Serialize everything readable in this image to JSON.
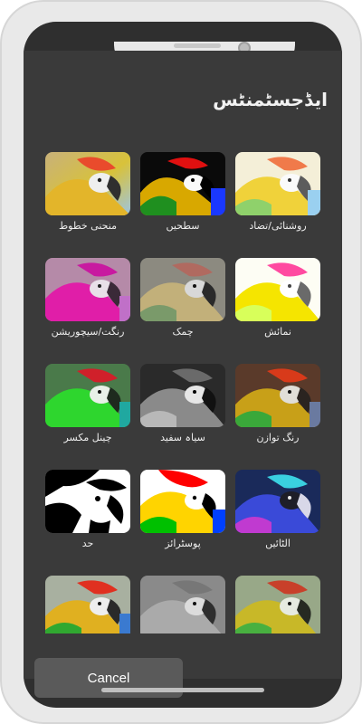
{
  "header": {
    "title": "ایڈجسٹمنٹس"
  },
  "actions": {
    "cancel_label": "Cancel"
  },
  "effects": [
    {
      "label": "منحنی خطوط"
    },
    {
      "label": "سطحیں"
    },
    {
      "label": "روشنائی/تضاد"
    },
    {
      "label": "رنگت/سیچوریشن"
    },
    {
      "label": "چمک"
    },
    {
      "label": "نمائش"
    },
    {
      "label": "چینل مکسر"
    },
    {
      "label": "سیاہ سفید"
    },
    {
      "label": "رنگ توازن"
    },
    {
      "label": "حد"
    },
    {
      "label": "پوسٹرائز"
    },
    {
      "label": "الٹائیں"
    },
    {
      "label": ""
    },
    {
      "label": ""
    },
    {
      "label": ""
    }
  ]
}
